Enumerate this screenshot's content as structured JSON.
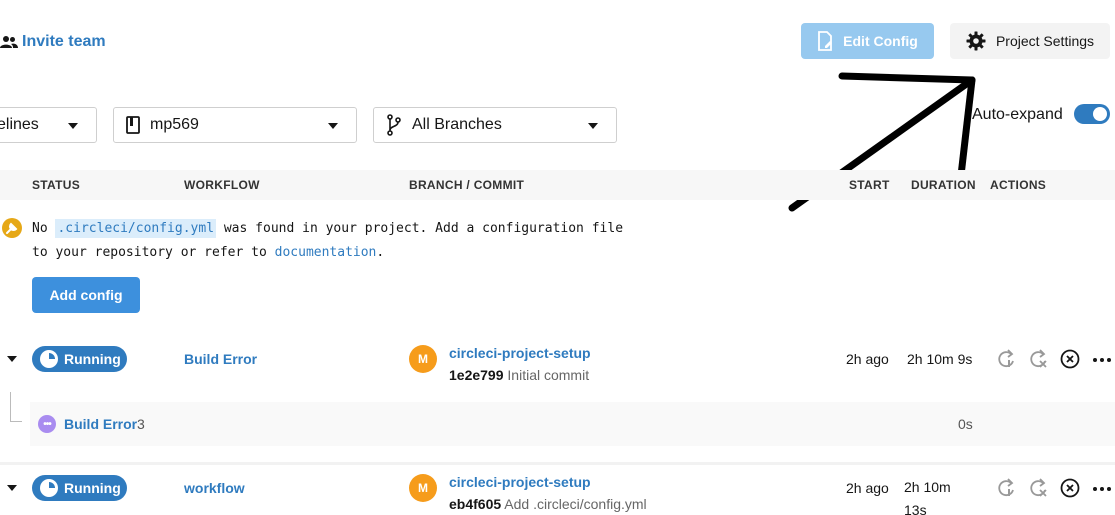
{
  "header": {
    "invite_label": "Invite team",
    "edit_config_label": "Edit Config",
    "project_settings_label": "Project Settings"
  },
  "filters": {
    "pipelines_label": "elines",
    "project_label": "mp569",
    "branches_label": "All Branches",
    "auto_expand_label": "Auto-expand",
    "auto_expand_on": true
  },
  "table": {
    "columns": [
      "STATUS",
      "WORKFLOW",
      "BRANCH / COMMIT",
      "START",
      "DURATION",
      "ACTIONS"
    ]
  },
  "notice": {
    "text_1": "No ",
    "code": ".circleci/config.yml",
    "text_2": " was found in your project. Add a configuration file",
    "text_3": "to your repository or refer to ",
    "doc_link": "documentation",
    "text_4": ".",
    "add_config_label": "Add config"
  },
  "pipelines": [
    {
      "status": "Running",
      "workflow": "Build Error",
      "avatar": "M",
      "branch": "circleci-project-setup",
      "commit_hash": "1e2e799",
      "commit_msg": "Initial commit",
      "start": "2h ago",
      "duration": "2h 10m 9s",
      "jobs": [
        {
          "name": "Build Error",
          "count": "3",
          "duration": "0s"
        }
      ]
    },
    {
      "status": "Running",
      "workflow": "workflow",
      "avatar": "M",
      "branch": "circleci-project-setup",
      "commit_hash": "eb4f605",
      "commit_msg": "Add .circleci/config.yml",
      "start": "2h ago",
      "duration_line1": "2h 10m",
      "duration_line2": "13s"
    }
  ],
  "colors": {
    "accent": "#2f7bbf",
    "button_primary": "#3d90dd",
    "button_disabled": "#97c9ef",
    "avatar": "#f69c1b",
    "warning_icon": "#e6a817",
    "job_icon": "#a98cf0"
  }
}
